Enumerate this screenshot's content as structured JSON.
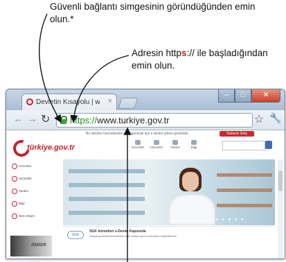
{
  "annotations": {
    "top": "Güvenli bağlantı simgesinin göründüğünden emin olun.*",
    "https_pre": "Adresin http",
    "https_red": "s",
    "https_post": ":// ile başladığından emin olun."
  },
  "browser": {
    "tab_title": "Devletin Kısayolu | www.tür",
    "tab_close": "×",
    "url_scheme": "https://",
    "url_host": "www.turkiye.gov.tr"
  },
  "page": {
    "logo_text": "türkiye.gov.tr",
    "notice": "Bu siteden hizmetlerden faydalanmak için e-devlet şifresi gereklidir.",
    "login_label": "Sisteme Giriş",
    "nav": [
      "Kurumlar",
      "Hizmetler",
      "Yardım",
      "Bilgi"
    ],
    "sidebar": [
      "Kurumlar",
      "Hizmetler",
      "Yardım",
      "Bilgi",
      "Bize Ulaşın"
    ],
    "signature": "Atatürk",
    "news_logo": "SGK",
    "news_title": "SGK hizmetleri e-Devlet Kapısında",
    "news_text": "Sosyal güvenlik hizmetlerine artık türkiye.gov.tr üzerinden erişebilirsiniz."
  },
  "icons": {
    "lock": "lock-icon",
    "star": "star-icon",
    "wrench": "wrench-icon"
  },
  "colors": {
    "secure_green": "#1a8a1a",
    "brand_red": "#c8202a",
    "annotation_red": "#d0202a"
  }
}
